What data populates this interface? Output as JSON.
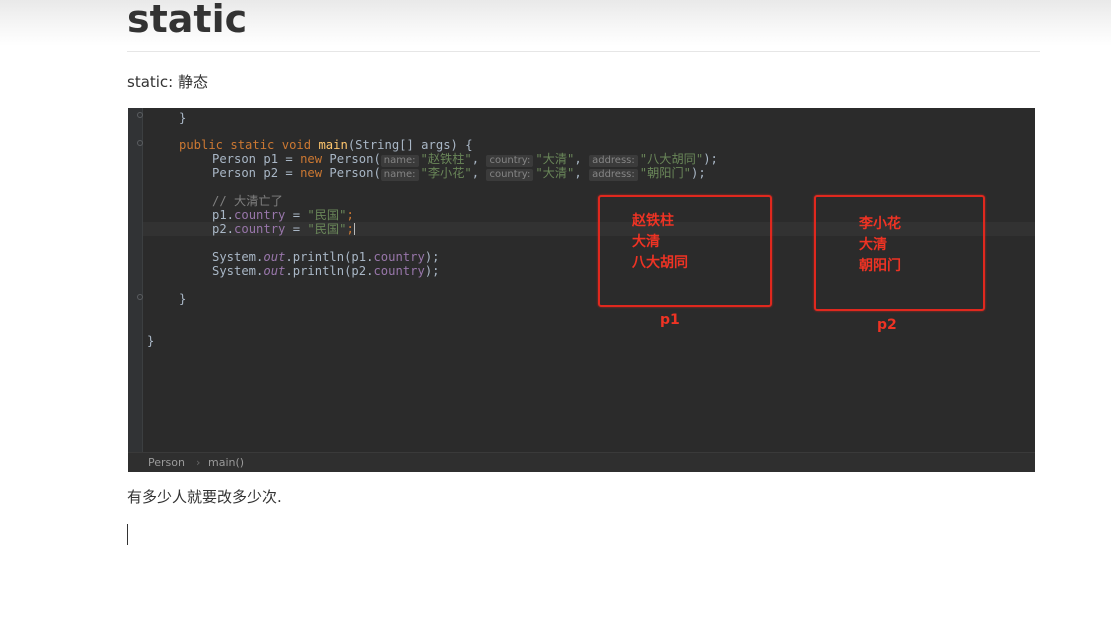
{
  "document": {
    "heading": "static",
    "intro": "static: 静态",
    "after": "有多少人就要改多少次."
  },
  "code_screenshot": {
    "lines": {
      "close_prev": "}",
      "main_sig": {
        "kw1": "public",
        "kw2": "static",
        "kw3": "void",
        "name": "main",
        "rest": "(String[] args) {"
      },
      "p1": {
        "prefix": "Person p1 = ",
        "new": "new",
        "cls": " Person(",
        "hint_name": "name:",
        "arg_name": "\"赵铁柱\"",
        "hint_country": "country:",
        "arg_country": "\"大清\"",
        "hint_address": "address:",
        "arg_address": "\"八大胡同\"",
        "end": ");"
      },
      "p2": {
        "prefix": "Person p2 = ",
        "new": "new",
        "cls": " Person(",
        "hint_name": "name:",
        "arg_name": "\"李小花\"",
        "hint_country": "country:",
        "arg_country": "\"大清\"",
        "hint_address": "address:",
        "arg_address": "\"朝阳门\"",
        "end": ");"
      },
      "comment": "// 大清亡了",
      "assign1": {
        "obj": "p1.",
        "field": "country",
        "eq": " = ",
        "val": "\"民国\"",
        "end": ";"
      },
      "assign2": {
        "obj": "p2.",
        "field": "country",
        "eq": " = ",
        "val": "\"民国\"",
        "end": ";"
      },
      "print1": {
        "sys": "System.",
        "out": "out",
        "call": ".println(p1.",
        "field": "country",
        "end": ");"
      },
      "print2": {
        "sys": "System.",
        "out": "out",
        "call": ".println(p2.",
        "field": "country",
        "end": ");"
      },
      "close_main": "}",
      "close_class": "}"
    },
    "breadcrumb": {
      "class_name": "Person",
      "separator": "›",
      "method": "main()"
    },
    "annotations": {
      "p1_box": "赵铁柱\n大清\n八大胡同",
      "p1_label": "p1",
      "p2_box": "李小花\n大清\n朝阳门",
      "p2_label": "p2"
    },
    "colors": {
      "background": "#2b2b2b",
      "keyword": "#cc7832",
      "method": "#ffc66d",
      "string": "#6a8759",
      "field": "#9876aa",
      "comment": "#808080",
      "annotation": "#ee3324"
    }
  }
}
